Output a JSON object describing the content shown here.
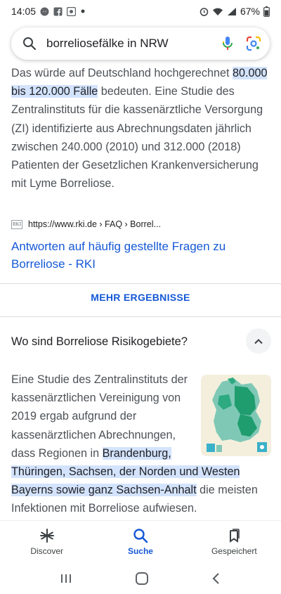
{
  "status_bar": {
    "time": "14:05",
    "battery": "67%"
  },
  "search": {
    "query": "borreliosefälke in NRW"
  },
  "result": {
    "text_before": "Das würde auf Deutschland hochgerechnet ",
    "highlight": "80.000 bis 120.000 Fälle",
    "text_after": " bedeuten. Eine Studie des Zentralinstituts für die kassenärztliche Versorgung (ZI) identifizierte aus Abrechnungsdaten jährlich zwischen 240.000 (2010) und 312.000 (2018) Patienten der Gesetzlichen Krankenversicherung mit Lyme Borreliose.",
    "favicon_text": "RKI",
    "source_url": "https://www.rki.de › FAQ › Borrel...",
    "link_title": "Antworten auf häufig gestellte Fragen zu Borreliose - RKI"
  },
  "more_results_label": "MEHR ERGEBNISSE",
  "faq": {
    "question": "Wo sind Borreliose Risikogebiete?",
    "answer_before": "Eine Studie des Zentralinstituts der kassenärztlichen Vereinigung von 2019 ergab aufgrund der kassenärztlichen Abrechnungen, dass Regionen in ",
    "answer_highlight": "Brandenburg, Thüringen, Sachsen, der Norden und Westen Bayerns sowie ganz Sachsen-Anhalt",
    "answer_after": " die meisten Infektionen mit Borreliose aufwiesen."
  },
  "bottom_nav": {
    "items": [
      {
        "label": "Discover",
        "icon": "asterisk-icon",
        "active": false
      },
      {
        "label": "Suche",
        "icon": "search-icon",
        "active": true
      },
      {
        "label": "Gespeichert",
        "icon": "saved-icon",
        "active": false
      }
    ]
  },
  "colors": {
    "link": "#1558d6",
    "highlight": "#d3e3fd",
    "body_text": "#4d5156"
  }
}
